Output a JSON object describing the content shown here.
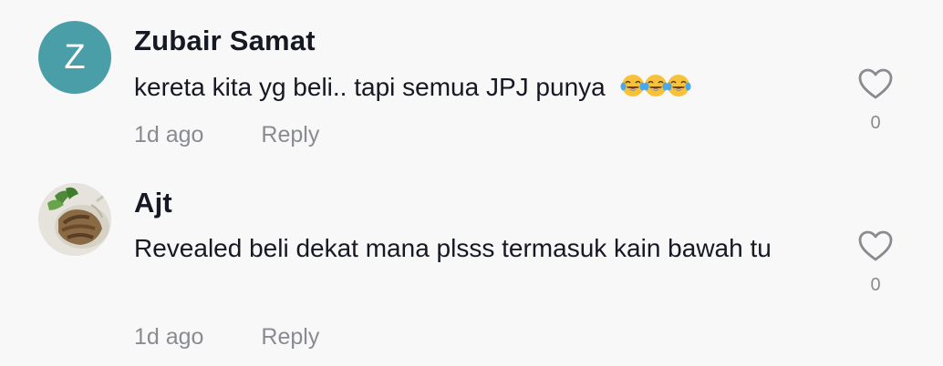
{
  "comments": [
    {
      "username": "Zubair Samat",
      "avatar_letter": "Z",
      "text": "kereta kita yg beli.. tapi semua JPJ punya",
      "emoji": [
        "tears-of-joy-emoji",
        "tears-of-joy-emoji",
        "tears-of-joy-emoji"
      ],
      "time": "1d ago",
      "reply_label": "Reply",
      "likes": "0"
    },
    {
      "username": "Ajt",
      "text": "Revealed beli dekat mana plsss termasuk kain bawah tu",
      "time": "1d ago",
      "reply_label": "Reply",
      "likes": "0"
    }
  ],
  "colors": {
    "avatar_bg": "#4a9ea8",
    "meta_text": "#8a8b91",
    "primary_text": "#161823"
  }
}
